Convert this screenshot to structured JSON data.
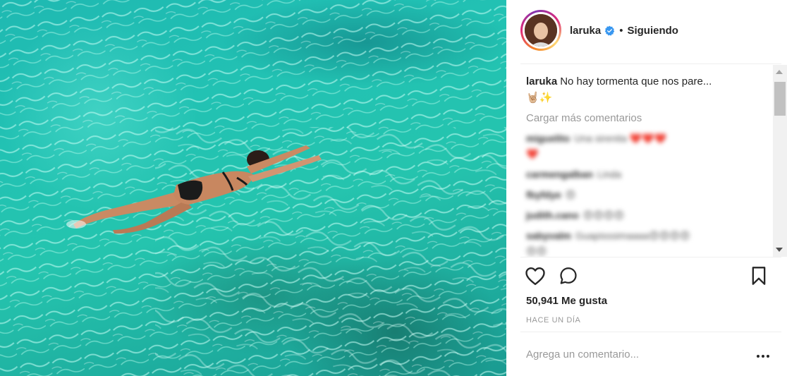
{
  "post": {
    "username": "laruka",
    "follow_status": "Siguiendo",
    "separator": "•",
    "caption_user": "laruka",
    "caption_text": "No hay tormenta que nos pare...",
    "caption_emojis": "🤘🏼✨",
    "load_more_label": "Cargar más comentarios",
    "likes": "50,941 Me gusta",
    "time_ago": "HACE UN DÍA",
    "add_comment_placeholder": "Agrega un comentario...",
    "comments": [
      {
        "user": "miguelito",
        "text": "Una sirenita ❤️❤️❤️"
      },
      {
        "user": "",
        "text": "❤️"
      },
      {
        "user": "carmengalban",
        "text": "Linda"
      },
      {
        "user": "fbyfdye",
        "text": "😍"
      },
      {
        "user": "judith.cano",
        "text": "😍😍😍😍"
      },
      {
        "user": "sabyvalm",
        "text": "Guapisssimaaaa😍😍😍😍"
      },
      {
        "user": "",
        "text": "😍😍"
      }
    ]
  },
  "colors": {
    "verified_badge": "#3897f0",
    "muted_text": "#999999",
    "water": "#22c2b3"
  },
  "icons": {
    "like": "heart-outline-icon",
    "comment": "comment-bubble-icon",
    "save": "bookmark-outline-icon",
    "more": "more-options-icon",
    "verified": "verified-badge-icon"
  }
}
